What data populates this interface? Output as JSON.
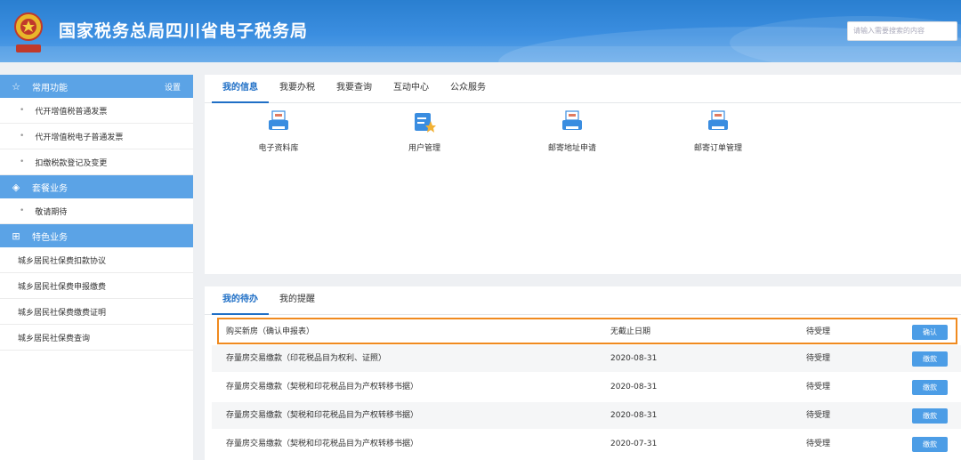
{
  "header": {
    "title": "国家税务总局四川省电子税务局",
    "search_placeholder": "请输入需要搜索的内容"
  },
  "sidebar": {
    "common": {
      "label": "常用功能",
      "setting": "设置"
    },
    "common_items": [
      "代开增值税普通发票",
      "代开增值税电子普通发票",
      "扣缴税款登记及变更"
    ],
    "package": {
      "label": "套餐业务"
    },
    "package_items": [
      "敬请期待"
    ],
    "special": {
      "label": "特色业务"
    },
    "special_items": [
      "城乡居民社保费扣款协议",
      "城乡居民社保费申报缴费",
      "城乡居民社保费缴费证明",
      "城乡居民社保费查询"
    ]
  },
  "top_tabs": [
    "我的信息",
    "我要办税",
    "我要查询",
    "互动中心",
    "公众服务"
  ],
  "tiles": [
    "电子资料库",
    "用户管理",
    "邮寄地址申请",
    "邮寄订单管理"
  ],
  "todo_tabs": [
    "我的待办",
    "我的提醒"
  ],
  "todo_rows": [
    {
      "name": "购买新房（确认申报表）",
      "date": "无截止日期",
      "status": "待受理",
      "action": "确认"
    },
    {
      "name": "存量房交易缴款（印花税品目为权利、证照）",
      "date": "2020-08-31",
      "status": "待受理",
      "action": "缴款"
    },
    {
      "name": "存量房交易缴款（契税和印花税品目为产权转移书据）",
      "date": "2020-08-31",
      "status": "待受理",
      "action": "缴款"
    },
    {
      "name": "存量房交易缴款（契税和印花税品目为产权转移书据）",
      "date": "2020-08-31",
      "status": "待受理",
      "action": "缴款"
    },
    {
      "name": "存量房交易缴款（契税和印花税品目为产权转移书据）",
      "date": "2020-07-31",
      "status": "待受理",
      "action": "缴款"
    }
  ],
  "colors": {
    "accent": "#1f6fc6",
    "sidebar_head": "#5ba3e6",
    "highlight": "#f08a1f",
    "button": "#4c9de6"
  }
}
